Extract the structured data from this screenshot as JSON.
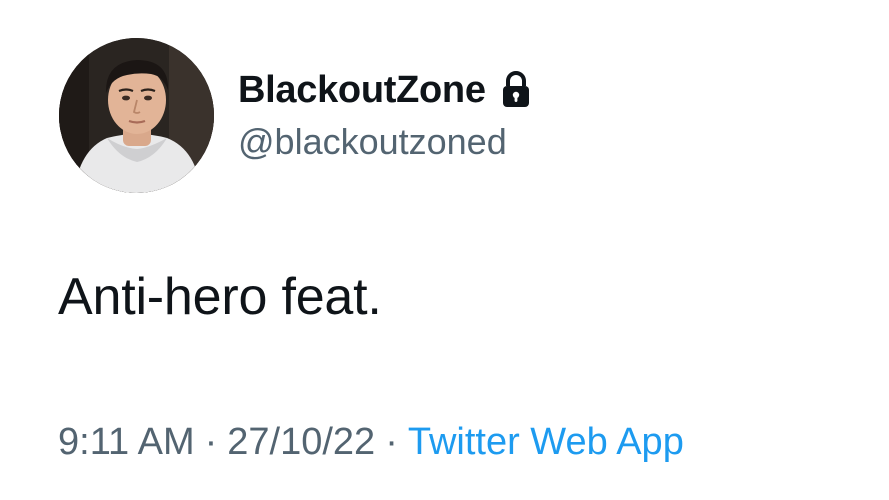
{
  "tweet": {
    "author": {
      "display_name": "BlackoutZone",
      "handle": "@blackoutzoned",
      "protected_icon": "lock-icon"
    },
    "text": "Anti-hero feat.",
    "time": "9:11 AM",
    "separator": "·",
    "date": "27/10/22",
    "source": "Twitter Web App"
  },
  "colors": {
    "text_primary": "#0f1419",
    "text_secondary": "#536471",
    "link": "#1d9bf0",
    "background": "#ffffff"
  }
}
